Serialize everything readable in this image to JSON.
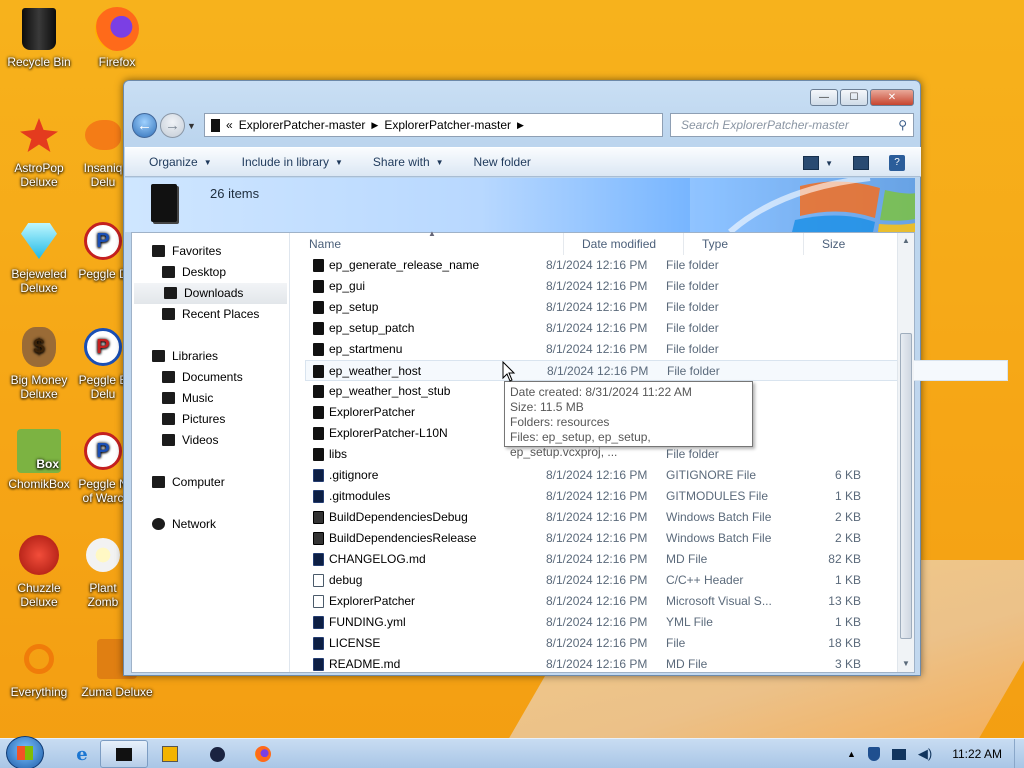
{
  "desktop": {
    "icons": [
      {
        "label": "Recycle Bin",
        "icon": "recycle-bin-icon"
      },
      {
        "label": "Firefox",
        "icon": "firefox-icon"
      },
      {
        "label": "AstroPop Deluxe",
        "icon": "astropop-icon"
      },
      {
        "label": "Insaniq Delu",
        "icon": "insaniquarium-icon"
      },
      {
        "label": "Bejeweled Deluxe",
        "icon": "bejeweled-icon"
      },
      {
        "label": "Peggle D",
        "icon": "peggle-icon"
      },
      {
        "label": "Big Money Deluxe",
        "icon": "big-money-icon"
      },
      {
        "label": "Peggle E Delu",
        "icon": "peggle-extreme-icon"
      },
      {
        "label": "ChomikBox",
        "icon": "chomikbox-icon",
        "badge": "Box"
      },
      {
        "label": "Peggle N of Warc",
        "icon": "peggle-nights-icon"
      },
      {
        "label": "Chuzzle Deluxe",
        "icon": "chuzzle-icon"
      },
      {
        "label": "Plant Zomb",
        "icon": "plants-zombies-icon"
      },
      {
        "label": "Everything",
        "icon": "everything-search-icon"
      },
      {
        "label": "Zuma Deluxe",
        "icon": "zuma-icon"
      }
    ]
  },
  "window": {
    "caption": {
      "minimize": "—",
      "maximize": "☐",
      "close": "✕"
    },
    "address": {
      "overflow": "«",
      "crumbs": [
        "ExplorerPatcher-master",
        "ExplorerPatcher-master"
      ]
    },
    "search_placeholder": "Search ExplorerPatcher-master",
    "toolbar": {
      "organize": "Organize",
      "include_in_library": "Include in library",
      "share_with": "Share with",
      "new_folder": "New folder"
    },
    "banner": {
      "item_count": "26 items"
    },
    "nav": {
      "favorites": "Favorites",
      "desktop": "Desktop",
      "downloads": "Downloads",
      "recent_places": "Recent Places",
      "libraries": "Libraries",
      "documents": "Documents",
      "music": "Music",
      "pictures": "Pictures",
      "videos": "Videos",
      "computer": "Computer",
      "network": "Network"
    },
    "columns": {
      "name": "Name",
      "date_modified": "Date modified",
      "type": "Type",
      "size": "Size"
    },
    "rows": [
      {
        "name": "ep_generate_release_name",
        "date": "8/1/2024 12:16 PM",
        "type": "File folder",
        "size": "",
        "icon": "folder-icon"
      },
      {
        "name": "ep_gui",
        "date": "8/1/2024 12:16 PM",
        "type": "File folder",
        "size": "",
        "icon": "folder-icon"
      },
      {
        "name": "ep_setup",
        "date": "8/1/2024 12:16 PM",
        "type": "File folder",
        "size": "",
        "icon": "folder-icon"
      },
      {
        "name": "ep_setup_patch",
        "date": "8/1/2024 12:16 PM",
        "type": "File folder",
        "size": "",
        "icon": "folder-icon"
      },
      {
        "name": "ep_startmenu",
        "date": "8/1/2024 12:16 PM",
        "type": "File folder",
        "size": "",
        "icon": "folder-icon"
      },
      {
        "name": "ep_weather_host",
        "date": "8/1/2024 12:16 PM",
        "type": "File folder",
        "size": "",
        "icon": "folder-icon",
        "hover": true
      },
      {
        "name": "ep_weather_host_stub",
        "date": "",
        "type": "",
        "size": "",
        "icon": "folder-icon"
      },
      {
        "name": "ExplorerPatcher",
        "date": "",
        "type": "",
        "size": "",
        "icon": "folder-icon"
      },
      {
        "name": "ExplorerPatcher-L10N",
        "date": "",
        "type": "",
        "size": "",
        "icon": "folder-icon"
      },
      {
        "name": "libs",
        "date": "",
        "type": "File folder",
        "size": "",
        "icon": "folder-icon"
      },
      {
        "name": ".gitignore",
        "date": "8/1/2024 12:16 PM",
        "type": "GITIGNORE File",
        "size": "6 KB",
        "icon": "file-icon"
      },
      {
        "name": ".gitmodules",
        "date": "8/1/2024 12:16 PM",
        "type": "GITMODULES File",
        "size": "1 KB",
        "icon": "file-icon"
      },
      {
        "name": "BuildDependenciesDebug",
        "date": "8/1/2024 12:16 PM",
        "type": "Windows Batch File",
        "size": "2 KB",
        "icon": "batch-file-icon"
      },
      {
        "name": "BuildDependenciesRelease",
        "date": "8/1/2024 12:16 PM",
        "type": "Windows Batch File",
        "size": "2 KB",
        "icon": "batch-file-icon"
      },
      {
        "name": "CHANGELOG.md",
        "date": "8/1/2024 12:16 PM",
        "type": "MD File",
        "size": "82 KB",
        "icon": "file-icon"
      },
      {
        "name": "debug",
        "date": "8/1/2024 12:16 PM",
        "type": "C/C++ Header",
        "size": "1 KB",
        "icon": "header-file-icon"
      },
      {
        "name": "ExplorerPatcher",
        "date": "8/1/2024 12:16 PM",
        "type": "Microsoft Visual S...",
        "size": "13 KB",
        "icon": "vs-solution-icon"
      },
      {
        "name": "FUNDING.yml",
        "date": "8/1/2024 12:16 PM",
        "type": "YML File",
        "size": "1 KB",
        "icon": "file-icon"
      },
      {
        "name": "LICENSE",
        "date": "8/1/2024 12:16 PM",
        "type": "File",
        "size": "18 KB",
        "icon": "file-icon"
      },
      {
        "name": "README.md",
        "date": "8/1/2024 12:16 PM",
        "type": "MD File",
        "size": "3 KB",
        "icon": "file-icon"
      }
    ],
    "tooltip": {
      "date_created": "Date created: 8/31/2024 11:22 AM",
      "size": "Size: 11.5 MB",
      "folders": "Folders: resources",
      "files": "Files: ep_setup, ep_setup, ep_setup.vcxproj, ..."
    }
  },
  "taskbar": {
    "clock": "11:22 AM",
    "tray_expand": "▲"
  }
}
